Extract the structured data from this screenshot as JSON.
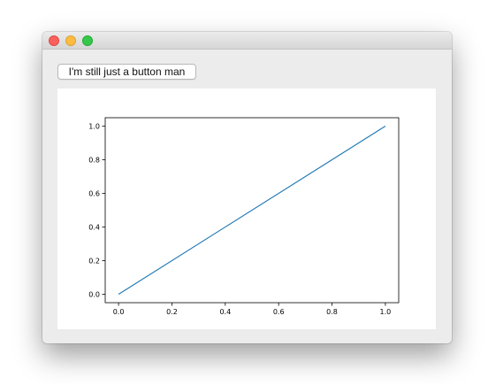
{
  "window": {
    "controls": [
      {
        "name": "close",
        "color": "#fc605c"
      },
      {
        "name": "minimize",
        "color": "#fdbc40"
      },
      {
        "name": "zoom",
        "color": "#34c84a"
      }
    ]
  },
  "button": {
    "label": "I'm still just a button man"
  },
  "chart_data": {
    "type": "line",
    "title": "",
    "xlabel": "",
    "ylabel": "",
    "x": [
      0.0,
      1.0
    ],
    "series": [
      {
        "values": [
          0.0,
          1.0
        ],
        "color": "#1f77b4"
      }
    ],
    "xlim": [
      -0.05,
      1.05
    ],
    "ylim": [
      -0.05,
      1.05
    ],
    "xticks": [
      "0.0",
      "0.2",
      "0.4",
      "0.6",
      "0.8",
      "1.0"
    ],
    "yticks": [
      "0.0",
      "0.2",
      "0.4",
      "0.6",
      "0.8",
      "1.0"
    ],
    "grid": false,
    "legend": false
  }
}
